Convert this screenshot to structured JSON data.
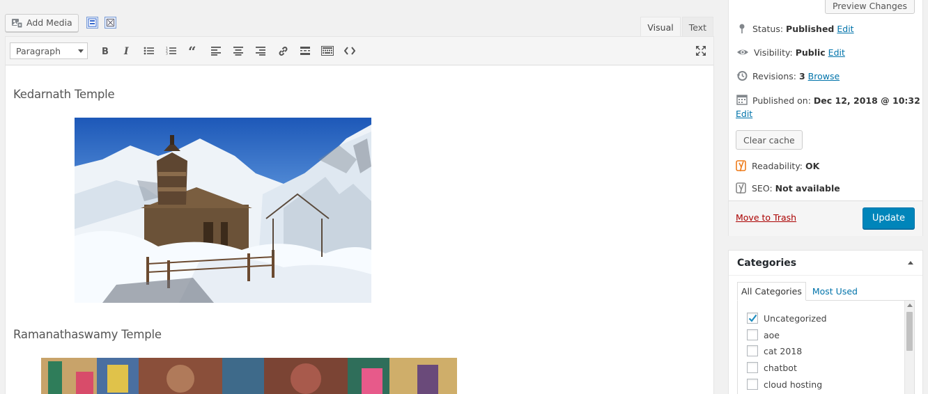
{
  "toolbar": {
    "add_media_label": "Add Media",
    "format_selected": "Paragraph",
    "tabs": [
      {
        "label": "Visual",
        "active": true
      },
      {
        "label": "Text",
        "active": false
      }
    ],
    "icons": [
      "bold-icon",
      "italic-icon",
      "bullet-list-icon",
      "numbered-list-icon",
      "blockquote-icon",
      "align-left-icon",
      "align-center-icon",
      "align-right-icon",
      "link-icon",
      "read-more-icon",
      "toolbar-toggle-icon",
      "code-icon",
      "fullscreen-icon"
    ]
  },
  "content": {
    "headings": [
      "Kedarnath Temple",
      "Ramanathaswamy Temple"
    ]
  },
  "publish": {
    "preview_label": "Preview Changes",
    "status_label": "Status:",
    "status_value": "Published",
    "edit_label": "Edit",
    "visibility_label": "Visibility:",
    "visibility_value": "Public",
    "revisions_label": "Revisions:",
    "revisions_value": "3",
    "browse_label": "Browse",
    "published_on_label": "Published on:",
    "published_on_value": "Dec 12, 2018 @ 10:32",
    "clear_cache_label": "Clear cache",
    "readability_label": "Readability:",
    "readability_value": "OK",
    "seo_label": "SEO:",
    "seo_value": "Not available",
    "trash_label": "Move to Trash",
    "update_label": "Update"
  },
  "categories": {
    "title": "Categories",
    "tab_all": "All Categories",
    "tab_most_used": "Most Used",
    "items": [
      {
        "label": "Uncategorized",
        "checked": true
      },
      {
        "label": "aoe",
        "checked": false
      },
      {
        "label": "cat 2018",
        "checked": false
      },
      {
        "label": "chatbot",
        "checked": false
      },
      {
        "label": "cloud hosting",
        "checked": false
      }
    ]
  },
  "colors": {
    "link": "#0073aa",
    "primary_button": "#0085ba",
    "trash": "#a00000",
    "readability_ok": "#ee7c1b"
  }
}
